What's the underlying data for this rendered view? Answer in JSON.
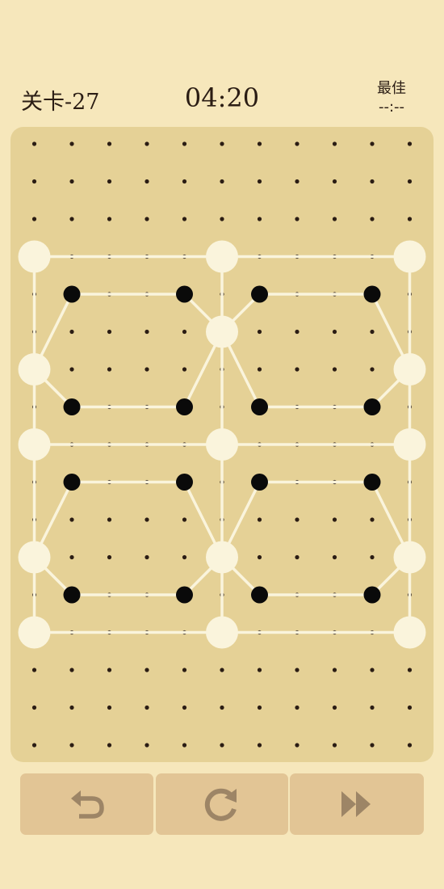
{
  "header": {
    "level_label": "关卡-27",
    "timer": "04:20",
    "best_label": "最佳",
    "best_value": "--:--"
  },
  "colors": {
    "background": "#f6e7bb",
    "board": "#e5d196",
    "grid_dot": "#2b1d14",
    "light_node": "#faf4dc",
    "dark_node": "#0a0a0a",
    "edge": "#faf4dc",
    "button": "#e2c595",
    "button_icon": "#9d8566"
  },
  "toolbar": {
    "undo_icon": "undo-arrow-icon",
    "restart_icon": "restart-icon",
    "skip_icon": "fast-forward-icon"
  }
}
